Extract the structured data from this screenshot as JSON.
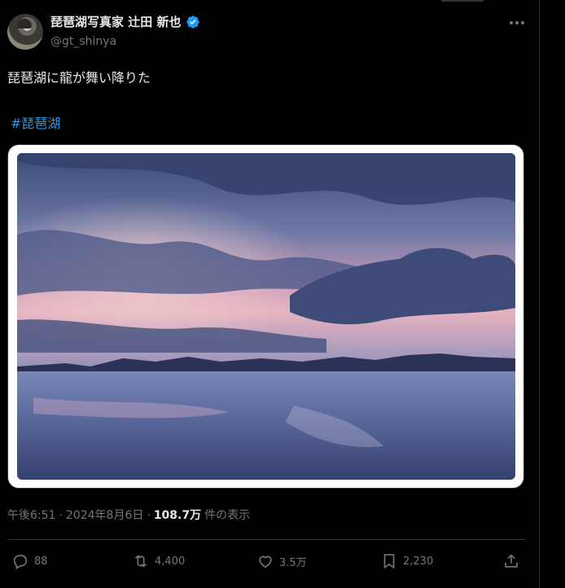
{
  "author": {
    "display_name": "琵琶湖写真家 辻田 新也",
    "handle": "@gt_shinya"
  },
  "tweet": {
    "text": "琵琶湖に龍が舞い降りた",
    "hashtag": "#琵琶湖"
  },
  "meta": {
    "time": "午後6:51",
    "separator": "·",
    "date": "2024年8月6日",
    "views_count": "108.7万",
    "views_label": "件の表示"
  },
  "actions": {
    "replies": "88",
    "reposts": "4,400",
    "likes": "3.5万",
    "bookmarks": "2,230"
  },
  "icons": {
    "verified": "verified-badge-icon",
    "more": "more-icon",
    "reply": "reply-icon",
    "repost": "repost-icon",
    "like": "like-icon",
    "bookmark": "bookmark-icon",
    "share": "share-icon"
  },
  "colors": {
    "background": "#000000",
    "text": "#e7e9ea",
    "muted": "#71767b",
    "accent": "#1d9bf0"
  }
}
